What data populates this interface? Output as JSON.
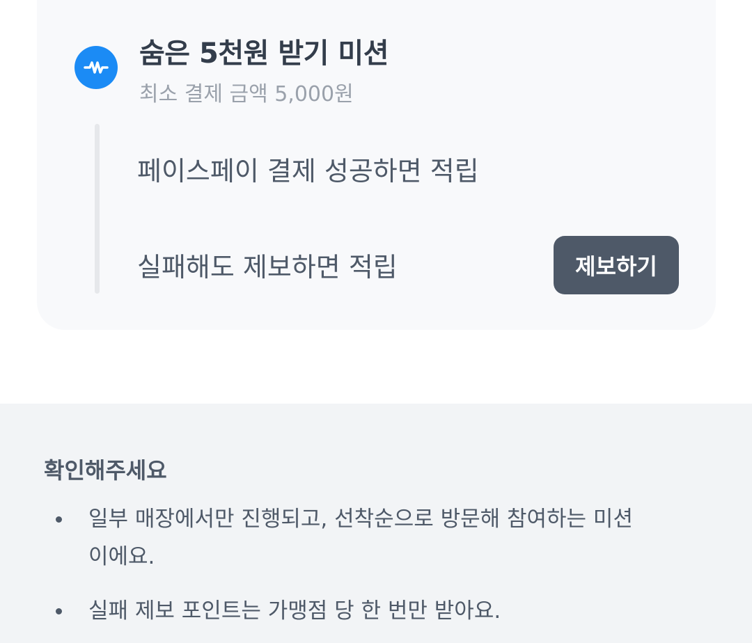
{
  "mission": {
    "icon": "w-logo-icon",
    "title": "숨은 5천원 받기 미션",
    "subtitle": "최소 결제 금액 5,000원",
    "steps": [
      {
        "label": "페이스페이 결제 성공하면 적립"
      },
      {
        "label": "실패해도 제보하면 적립"
      }
    ],
    "report_button": "제보하기"
  },
  "notice": {
    "title": "확인해주세요",
    "items": [
      "일부 매장에서만 진행되고, 선착순으로 방문해 참여하는 미션이에요.",
      "실패 제보 포인트는 가맹점 당 한 번만 받아요."
    ]
  },
  "colors": {
    "accent": "#1b8bf5",
    "card_bg": "#f8f9fb",
    "button_bg": "#4e5968",
    "notice_bg": "#f2f4f6"
  }
}
